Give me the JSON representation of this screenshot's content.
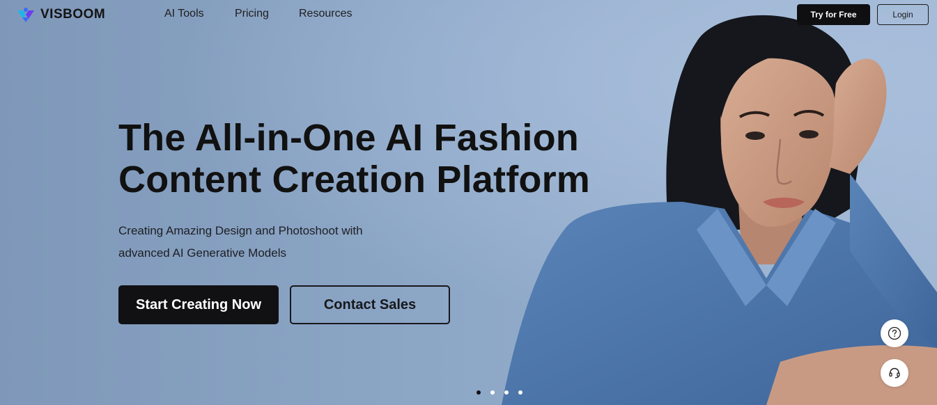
{
  "brand": {
    "name": "VISBOOM",
    "accent_colors": [
      "#3b6cf6",
      "#6a3ef0",
      "#1fb5e8"
    ]
  },
  "nav": {
    "links": [
      "AI Tools",
      "Pricing",
      "Resources"
    ],
    "try_label": "Try for Free",
    "login_label": "Login"
  },
  "hero": {
    "headline_line1": "The All-in-One AI Fashion",
    "headline_line2": "Content Creation Platform",
    "sub_line1": "Creating Amazing Design and Photoshoot with",
    "sub_line2": "advanced AI Generative Models",
    "primary_cta": "Start Creating Now",
    "secondary_cta": "Contact Sales",
    "carousel": {
      "total_slides": 4,
      "active_index": 0
    }
  },
  "helpers": {
    "help_icon": "question-circle-icon",
    "support_icon": "headset-icon"
  },
  "colors": {
    "background": "#8aa4c4",
    "shirt": "#4f78ab",
    "hair": "#14161b",
    "skin": "#c99a82",
    "dark_button": "#111114"
  }
}
